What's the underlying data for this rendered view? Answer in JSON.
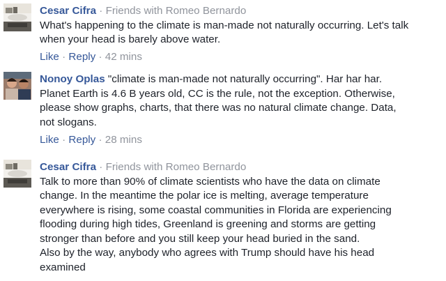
{
  "comments": [
    {
      "author": "Cesar Cifra",
      "relation": "Friends with Romeo Bernardo",
      "lines": [
        "What's happening to the climate is man-made not naturally occurring. Let's talk",
        "when your head is barely above water."
      ],
      "like_label": "Like",
      "reply_label": "Reply",
      "time": "42 mins",
      "separator": "·"
    },
    {
      "author": "Nonoy Oplas",
      "first_line_text": "\"climate is man-made not naturally occurring\". Har har har.",
      "lines": [
        "Planet Earth is 4.6 B years old, CC is the rule, not the exception. Otherwise,",
        "please show graphs, charts, that there was no natural climate change. Data,",
        "not slogans."
      ],
      "like_label": "Like",
      "reply_label": "Reply",
      "time": "28 mins",
      "separator": "·"
    },
    {
      "author": "Cesar Cifra",
      "relation": "Friends with Romeo Bernardo",
      "lines": [
        "Talk to more than 90% of climate scientists who have the data on climate",
        "change. In the meantime the polar ice is melting, average temperature",
        "everywhere is rising, some coastal communities in Florida are experiencing",
        "flooding during high tides, Greenland is greening and storms are getting",
        "stronger than before and you still keep your head buried in the sand.",
        "Also by the way, anybody who agrees with Trump should have his head",
        "examined"
      ],
      "separator": "·"
    }
  ],
  "colors": {
    "author": "#365899",
    "meta": "#90949c",
    "text": "#1d2129",
    "background": "#ffffff"
  }
}
